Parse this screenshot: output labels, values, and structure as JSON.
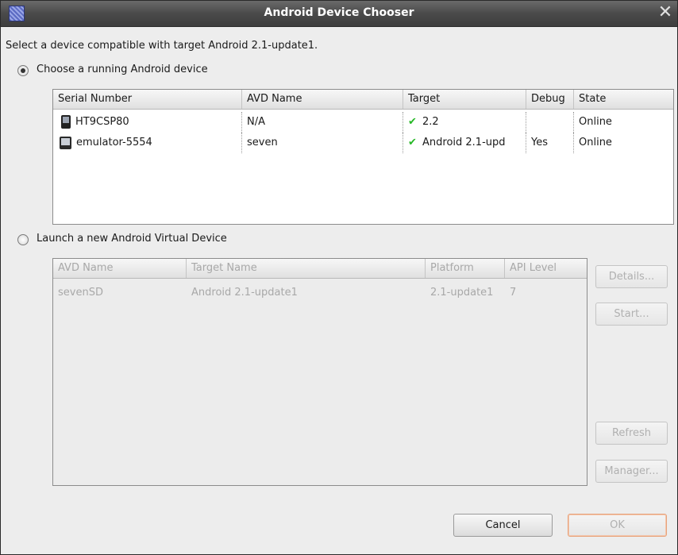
{
  "window": {
    "title": "Android Device Chooser",
    "close_glyph": "✕"
  },
  "prompt": "Select a device compatible with target Android 2.1-update1.",
  "running": {
    "radio_label": "Choose a running Android device",
    "columns": [
      "Serial Number",
      "AVD Name",
      "Target",
      "Debug",
      "State"
    ],
    "rows": [
      {
        "icon": "phone-icon",
        "serial": "HT9CSP80",
        "avd": "N/A",
        "target": "2.2",
        "target_check": true,
        "debug": "",
        "state": "Online"
      },
      {
        "icon": "emulator-icon",
        "serial": "emulator-5554",
        "avd": "seven",
        "target": "Android 2.1-upd",
        "target_check": true,
        "debug": "Yes",
        "state": "Online"
      }
    ]
  },
  "launch": {
    "radio_label": "Launch a new Android Virtual Device",
    "columns": [
      "AVD Name",
      "Target Name",
      "Platform",
      "API Level"
    ],
    "rows": [
      {
        "avd": "sevenSD",
        "target": "Android 2.1-update1",
        "platform": "2.1-update1",
        "api": "7"
      }
    ],
    "buttons": {
      "details": "Details...",
      "start": "Start...",
      "refresh": "Refresh",
      "manager": "Manager..."
    }
  },
  "footer": {
    "cancel": "Cancel",
    "ok": "OK"
  },
  "colors": {
    "title_bg": "#4a4a4a",
    "dialog_bg": "#ededed",
    "check": "#27b827",
    "ok_focus": "#e8a27a"
  }
}
